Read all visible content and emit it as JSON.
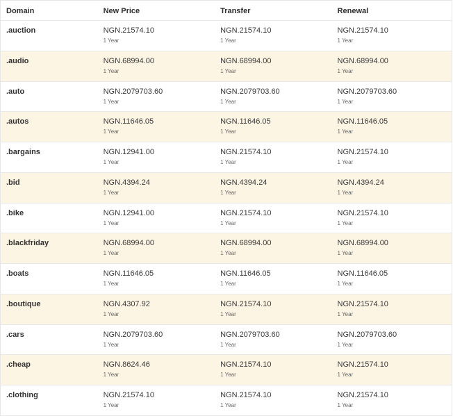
{
  "headers": {
    "domain": "Domain",
    "new_price": "New Price",
    "transfer": "Transfer",
    "renewal": "Renewal"
  },
  "colors": {
    "alt_row": "#fdf5e4",
    "border": "#e8e8e8"
  },
  "rows": [
    {
      "domain": ".auction",
      "new_price": "NGN.21574.10",
      "new_period": "1 Year",
      "transfer": "NGN.21574.10",
      "transfer_period": "1 Year",
      "renewal": "NGN.21574.10",
      "renewal_period": "1 Year"
    },
    {
      "domain": ".audio",
      "new_price": "NGN.68994.00",
      "new_period": "1 Year",
      "transfer": "NGN.68994.00",
      "transfer_period": "1 Year",
      "renewal": "NGN.68994.00",
      "renewal_period": "1 Year"
    },
    {
      "domain": ".auto",
      "new_price": "NGN.2079703.60",
      "new_period": "1 Year",
      "transfer": "NGN.2079703.60",
      "transfer_period": "1 Year",
      "renewal": "NGN.2079703.60",
      "renewal_period": "1 Year"
    },
    {
      "domain": ".autos",
      "new_price": "NGN.11646.05",
      "new_period": "1 Year",
      "transfer": "NGN.11646.05",
      "transfer_period": "1 Year",
      "renewal": "NGN.11646.05",
      "renewal_period": "1 Year"
    },
    {
      "domain": ".bargains",
      "new_price": "NGN.12941.00",
      "new_period": "1 Year",
      "transfer": "NGN.21574.10",
      "transfer_period": "1 Year",
      "renewal": "NGN.21574.10",
      "renewal_period": "1 Year"
    },
    {
      "domain": ".bid",
      "new_price": "NGN.4394.24",
      "new_period": "1 Year",
      "transfer": "NGN.4394.24",
      "transfer_period": "1 Year",
      "renewal": "NGN.4394.24",
      "renewal_period": "1 Year"
    },
    {
      "domain": ".bike",
      "new_price": "NGN.12941.00",
      "new_period": "1 Year",
      "transfer": "NGN.21574.10",
      "transfer_period": "1 Year",
      "renewal": "NGN.21574.10",
      "renewal_period": "1 Year"
    },
    {
      "domain": ".blackfriday",
      "new_price": "NGN.68994.00",
      "new_period": "1 Year",
      "transfer": "NGN.68994.00",
      "transfer_period": "1 Year",
      "renewal": "NGN.68994.00",
      "renewal_period": "1 Year"
    },
    {
      "domain": ".boats",
      "new_price": "NGN.11646.05",
      "new_period": "1 Year",
      "transfer": "NGN.11646.05",
      "transfer_period": "1 Year",
      "renewal": "NGN.11646.05",
      "renewal_period": "1 Year"
    },
    {
      "domain": ".boutique",
      "new_price": "NGN.4307.92",
      "new_period": "1 Year",
      "transfer": "NGN.21574.10",
      "transfer_period": "1 Year",
      "renewal": "NGN.21574.10",
      "renewal_period": "1 Year"
    },
    {
      "domain": ".cars",
      "new_price": "NGN.2079703.60",
      "new_period": "1 Year",
      "transfer": "NGN.2079703.60",
      "transfer_period": "1 Year",
      "renewal": "NGN.2079703.60",
      "renewal_period": "1 Year"
    },
    {
      "domain": ".cheap",
      "new_price": "NGN.8624.46",
      "new_period": "1 Year",
      "transfer": "NGN.21574.10",
      "transfer_period": "1 Year",
      "renewal": "NGN.21574.10",
      "renewal_period": "1 Year"
    },
    {
      "domain": ".clothing",
      "new_price": "NGN.21574.10",
      "new_period": "1 Year",
      "transfer": "NGN.21574.10",
      "transfer_period": "1 Year",
      "renewal": "NGN.21574.10",
      "renewal_period": "1 Year"
    }
  ]
}
